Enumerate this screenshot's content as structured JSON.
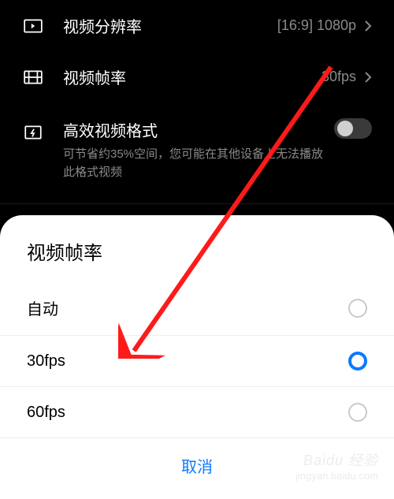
{
  "settings": {
    "resolution": {
      "label": "视频分辨率",
      "value": "[16:9] 1080p"
    },
    "framerate": {
      "label": "视频帧率",
      "value": "30fps"
    },
    "efficient": {
      "title": "高效视频格式",
      "subtitle": "可节省约35%空间，您可能在其他设备上无法播放此格式视频",
      "enabled": false
    }
  },
  "sheet": {
    "title": "视频帧率",
    "options": [
      {
        "label": "自动",
        "selected": false
      },
      {
        "label": "30fps",
        "selected": true
      },
      {
        "label": "60fps",
        "selected": false
      }
    ],
    "cancel": "取消"
  },
  "watermark": {
    "brand": "Baidu 经验",
    "url": "jingyan.baidu.com"
  }
}
